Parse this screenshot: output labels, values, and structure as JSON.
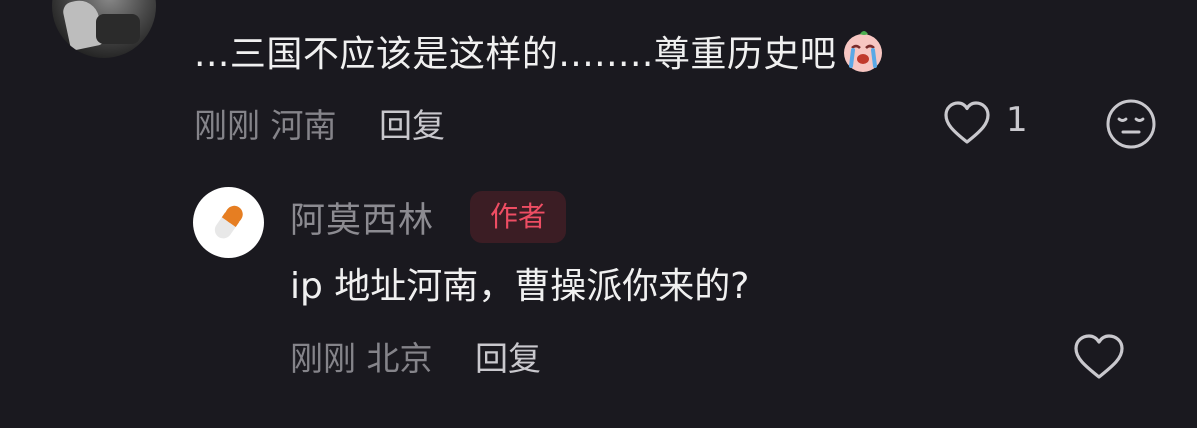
{
  "comment": {
    "username": "",
    "text": "...三国不应该是这样的........尊重历史吧",
    "emoji": "crying-face-emoji",
    "time": "刚刚",
    "location": "河南",
    "reply_label": "回复",
    "like_count": "1"
  },
  "reply": {
    "username": "阿莫西林",
    "author_badge": "作者",
    "text": "ip 地址河南，曹操派你来的?",
    "time": "刚刚",
    "location": "北京",
    "reply_label": "回复"
  },
  "colors": {
    "background": "#1a191f",
    "muted_text": "#85848a",
    "badge_text": "#ee4d63",
    "badge_bg": "#3b1d24"
  },
  "icons": {
    "like": "heart-outline-icon",
    "dislike": "neutral-face-icon"
  }
}
